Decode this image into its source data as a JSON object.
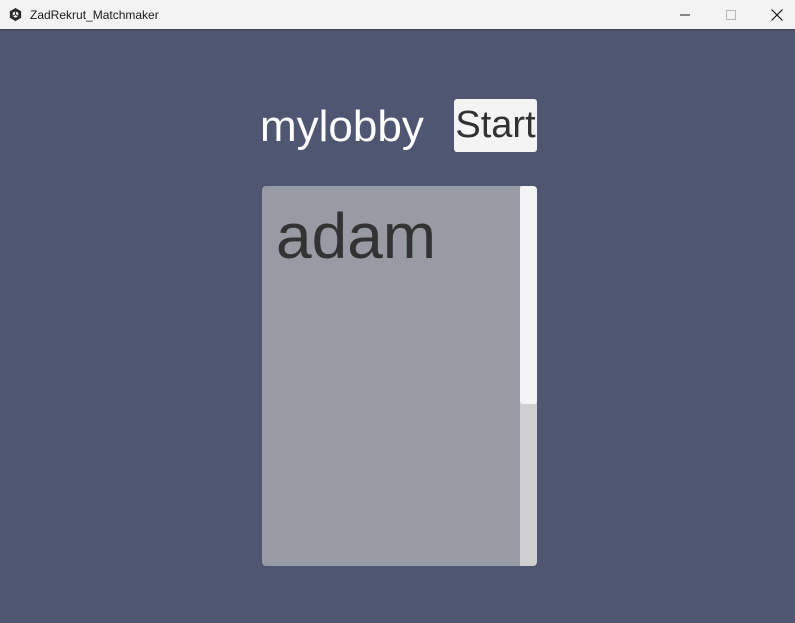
{
  "window": {
    "title": "ZadRekrut_Matchmaker",
    "minimize_icon": "minimize-icon",
    "maximize_icon": "maximize-icon",
    "close_icon": "close-icon"
  },
  "lobby": {
    "name": "mylobby",
    "start_label": "Start",
    "players": [
      "adam"
    ]
  },
  "colors": {
    "background": "#4f5672",
    "list_background": "#989ba3",
    "button_background": "#f4f4f4"
  }
}
